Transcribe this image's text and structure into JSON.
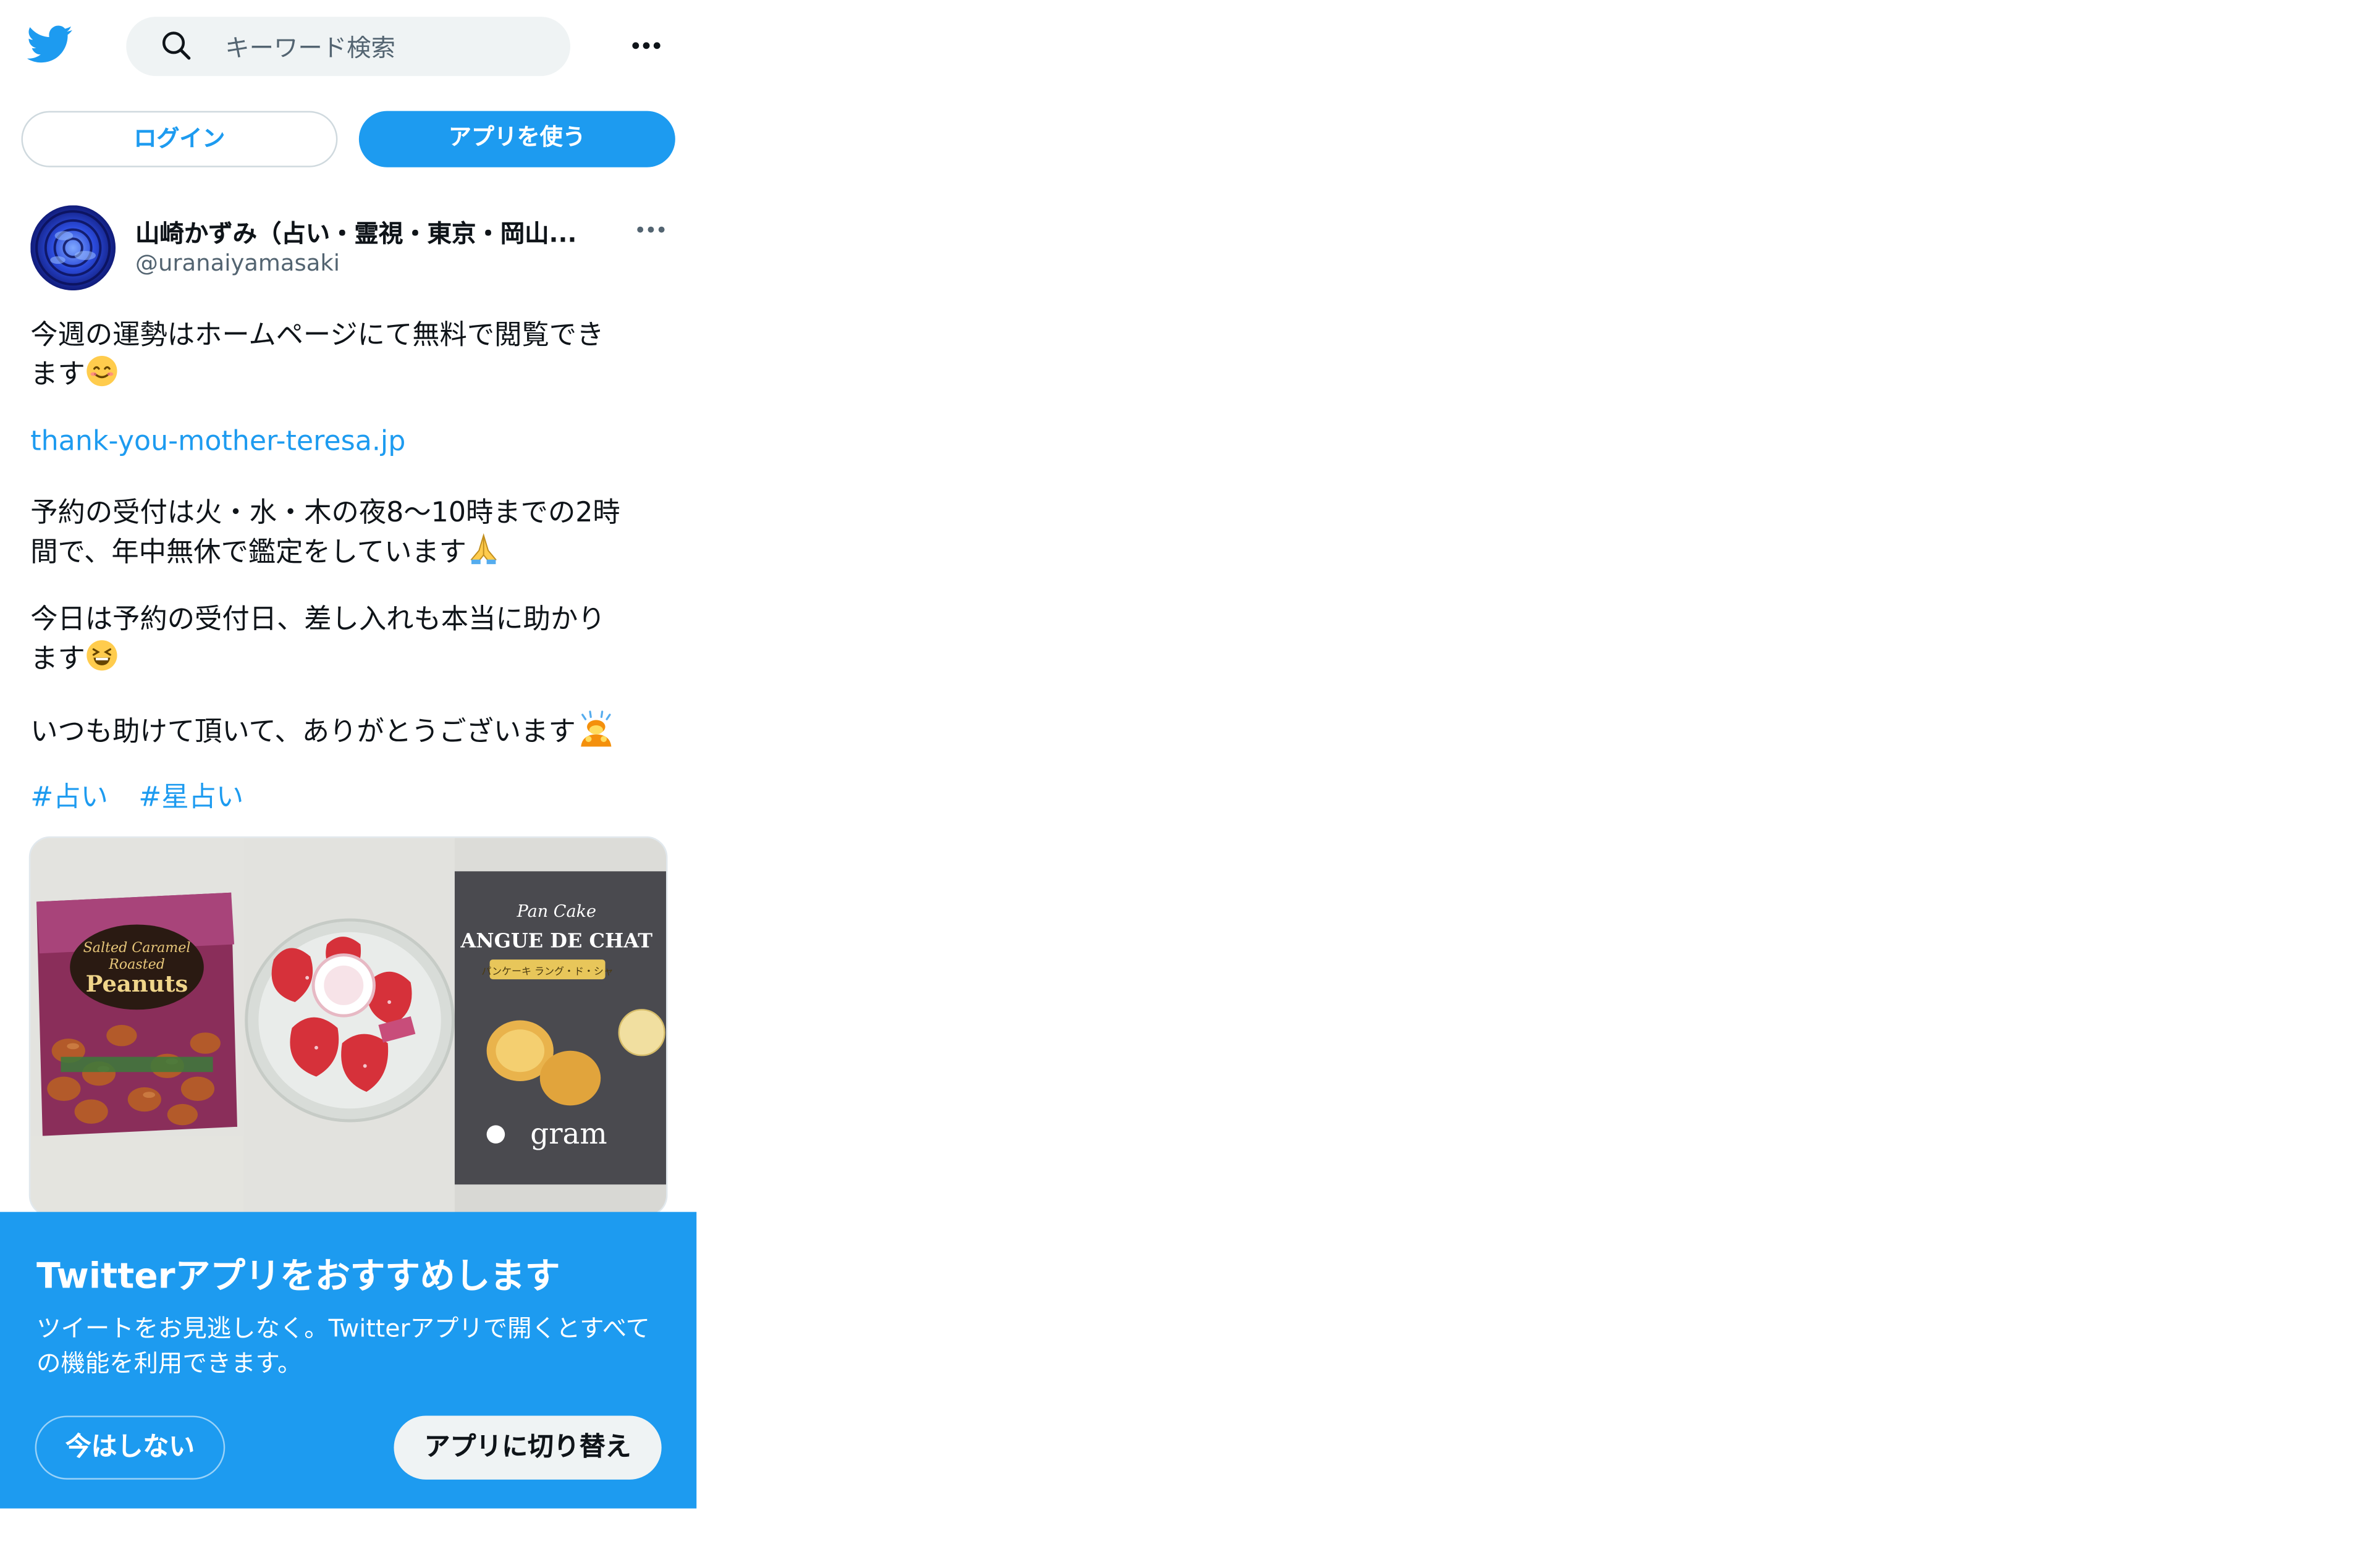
{
  "header": {
    "logo_icon": "twitter-bird-icon",
    "search_placeholder": "キーワード検索",
    "more_icon": "more-horizontal-icon"
  },
  "actions": {
    "login_label": "ログイン",
    "use_app_label": "アプリを使う"
  },
  "tweet": {
    "author_name": "山崎かずみ（占い・霊視・東京・岡山...",
    "author_handle": "@uranaiyamasaki",
    "line1": "今週の運勢はホームページにて無料で閲覧でき",
    "line2": "ます",
    "link": "thank-you-mother-teresa.jp",
    "para2_line1": "予約の受付は火・水・木の夜8〜10時までの2時",
    "para2_line2": "間で、年中無休で鑑定をしています",
    "para3_line1": "今日は予約の受付日、差し入れも本当に助かり",
    "para3_line2": "ます",
    "para4": "いつも助けて頂いて、ありがとうございます",
    "hashtag1": "#占い",
    "hashtag2": "#星占い",
    "media": {
      "img1_lettering": "Salted Caramel Roasted Peanuts",
      "img3_brand_line1": "Pan Cake",
      "img3_brand_line2": "ANGUE DE CHAT",
      "img3_label": "パンケーキ ラング・ド・シャ",
      "img3_logo": "gram"
    }
  },
  "prompt": {
    "title": "Twitterアプリをおすすめします",
    "body": "ツイートをお見逃しなく。Twitterアプリで開くとすべての機能を利用できます。",
    "not_now_label": "今はしない",
    "switch_label": "アプリに切り替え"
  },
  "colors": {
    "accent": "#1d9bf0",
    "text": "#0f1419",
    "secondary_text": "#536471",
    "search_bg": "#eff3f4"
  }
}
